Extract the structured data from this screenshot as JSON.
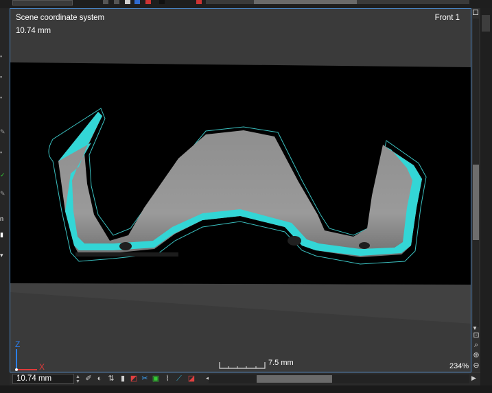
{
  "viewport": {
    "coord_system_label": "Scene coordinate system",
    "depth_label": "10.74 mm",
    "view_name": "Front 1",
    "scale_bar_label": "7.5 mm",
    "zoom_label": "234%",
    "axis_z": "Z",
    "axis_x": "X"
  },
  "bottombar": {
    "position_value": "10.74 mm"
  },
  "colors": {
    "highlight": "#33d6d6",
    "frame": "#4a86c5",
    "axis_z": "#2a7ff2",
    "axis_x": "#e03a3a"
  },
  "icons": {
    "toolbar": [
      "pan-icon",
      "shading-icon",
      "rotate-icon",
      "contrast-icon",
      "clip-icon",
      "cut-icon",
      "select-icon",
      "curve-icon",
      "measure-icon",
      "record-icon"
    ],
    "nav": [
      "fit-icon",
      "zoom-icon",
      "zoom-in-icon",
      "zoom-out-icon"
    ]
  }
}
